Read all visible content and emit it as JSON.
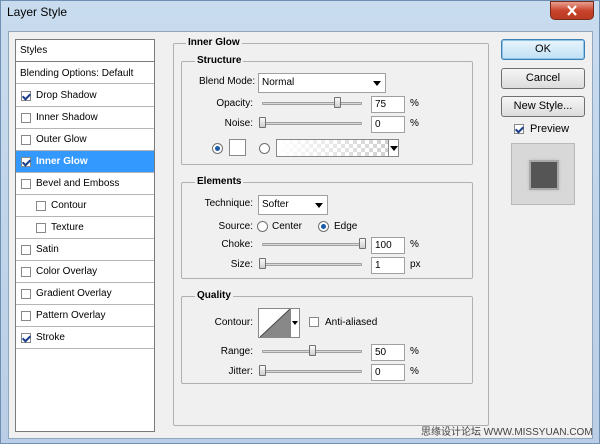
{
  "window": {
    "title": "Layer Style",
    "close_icon": "close-icon"
  },
  "styles_panel": {
    "header": "Styles",
    "blending_options": "Blending Options: Default",
    "items": [
      {
        "label": "Drop Shadow",
        "checked": true,
        "selected": false,
        "indent": false
      },
      {
        "label": "Inner Shadow",
        "checked": false,
        "selected": false,
        "indent": false
      },
      {
        "label": "Outer Glow",
        "checked": false,
        "selected": false,
        "indent": false
      },
      {
        "label": "Inner Glow",
        "checked": true,
        "selected": true,
        "indent": false
      },
      {
        "label": "Bevel and Emboss",
        "checked": false,
        "selected": false,
        "indent": false
      },
      {
        "label": "Contour",
        "checked": false,
        "selected": false,
        "indent": true
      },
      {
        "label": "Texture",
        "checked": false,
        "selected": false,
        "indent": true
      },
      {
        "label": "Satin",
        "checked": false,
        "selected": false,
        "indent": false
      },
      {
        "label": "Color Overlay",
        "checked": false,
        "selected": false,
        "indent": false
      },
      {
        "label": "Gradient Overlay",
        "checked": false,
        "selected": false,
        "indent": false
      },
      {
        "label": "Pattern Overlay",
        "checked": false,
        "selected": false,
        "indent": false
      },
      {
        "label": "Stroke",
        "checked": true,
        "selected": false,
        "indent": false
      }
    ]
  },
  "inner_glow": {
    "title": "Inner Glow",
    "structure": {
      "title": "Structure",
      "blend_mode_label": "Blend Mode:",
      "blend_mode_value": "Normal",
      "opacity_label": "Opacity:",
      "opacity_value": "75",
      "opacity_unit": "%",
      "opacity_level": 0.75,
      "noise_label": "Noise:",
      "noise_value": "0",
      "noise_unit": "%",
      "noise_level": 0,
      "color_swatch": "#ffffff"
    },
    "elements": {
      "title": "Elements",
      "technique_label": "Technique:",
      "technique_value": "Softer",
      "source_label": "Source:",
      "source_center": "Center",
      "source_edge": "Edge",
      "choke_label": "Choke:",
      "choke_value": "100",
      "choke_unit": "%",
      "choke_level": 1.0,
      "size_label": "Size:",
      "size_value": "1",
      "size_unit": "px",
      "size_level": 0.0
    },
    "quality": {
      "title": "Quality",
      "contour_label": "Contour:",
      "anti_aliased_label": "Anti-aliased",
      "range_label": "Range:",
      "range_value": "50",
      "range_unit": "%",
      "range_level": 0.5,
      "jitter_label": "Jitter:",
      "jitter_value": "0",
      "jitter_unit": "%",
      "jitter_level": 0
    }
  },
  "buttons": {
    "ok": "OK",
    "cancel": "Cancel",
    "new_style": "New Style...",
    "preview_label": "Preview",
    "preview_checked": true
  },
  "watermark": "思缘设计论坛  WWW.MISSYUAN.COM"
}
